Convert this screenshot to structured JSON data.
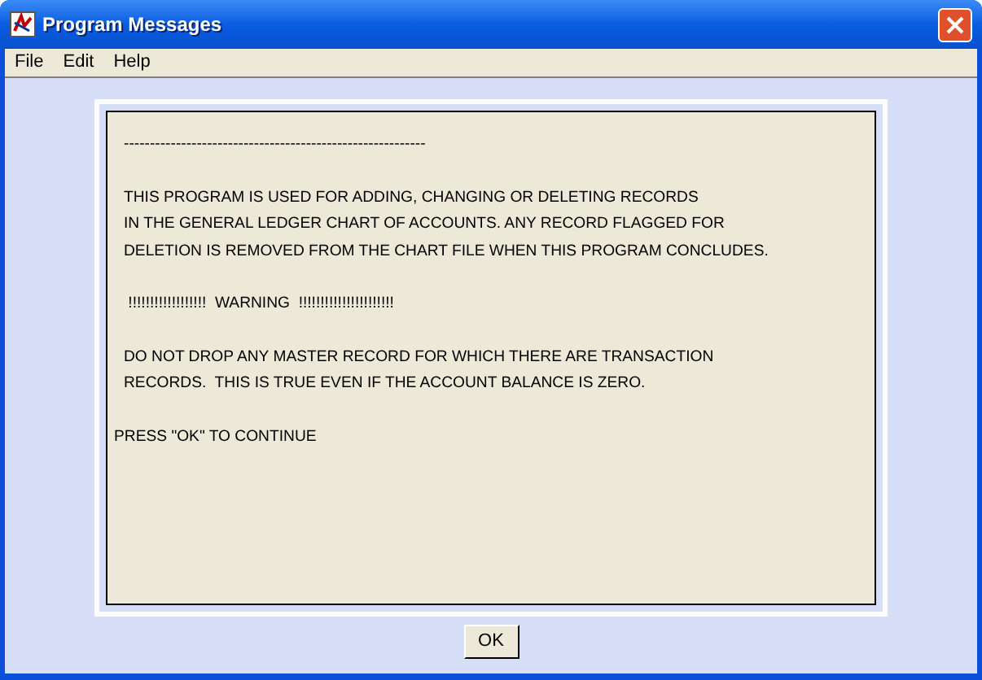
{
  "window": {
    "title": "Program Messages"
  },
  "menu": [
    "File",
    "Edit",
    "Help"
  ],
  "message": {
    "paragraphs": [
      {
        "indented": true,
        "lines": [
          "----------------------------------------------------------"
        ]
      },
      {
        "indented": true,
        "lines": [
          "THIS PROGRAM IS USED FOR ADDING, CHANGING OR DELETING RECORDS",
          "IN THE GENERAL LEDGER CHART OF ACCOUNTS. ANY RECORD FLAGGED FOR",
          "DELETION IS REMOVED FROM THE CHART FILE WHEN THIS PROGRAM CONCLUDES."
        ]
      },
      {
        "indented": true,
        "lines": [
          " !!!!!!!!!!!!!!!!!!  WARNING  !!!!!!!!!!!!!!!!!!!!!!"
        ]
      },
      {
        "indented": true,
        "lines": [
          "DO NOT DROP ANY MASTER RECORD FOR WHICH THERE ARE TRANSACTION",
          "RECORDS.  THIS IS TRUE EVEN IF THE ACCOUNT BALANCE IS ZERO."
        ]
      },
      {
        "indented": false,
        "lines": [
          "PRESS \"OK\" TO CONTINUE"
        ]
      }
    ]
  },
  "buttons": [
    "OK"
  ]
}
